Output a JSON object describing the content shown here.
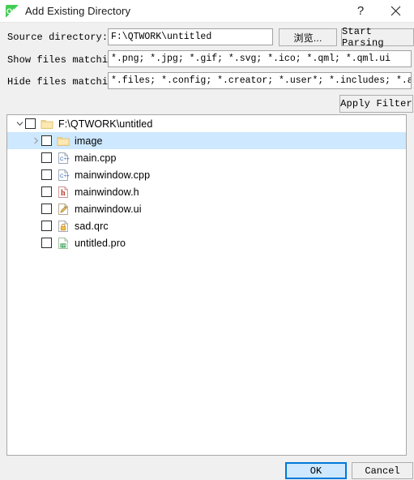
{
  "window": {
    "title": "Add Existing Directory",
    "icon": "qt-creator-icon",
    "help_label": "?",
    "close_label": "✕"
  },
  "form": {
    "source_label": "Source directory:",
    "source_value": "F:\\QTWORK\\untitled",
    "source_placeholder": "",
    "browse_label": "浏览...",
    "parse_label": "Start Parsing",
    "show_label": "Show files matching:",
    "show_value": "*.png; *.jpg; *.gif; *.svg; *.ico; *.qml; *.qml.ui",
    "show_placeholder": "",
    "hide_label": "Hide files matching:",
    "hide_value": "*.files; *.config; *.creator; *.user*; *.includes; *.autosave",
    "hide_placeholder": "",
    "apply_filter_label": "Apply Filter"
  },
  "tree": {
    "rows": [
      {
        "label": "F:\\QTWORK\\untitled",
        "icon": "folder-icon",
        "indent": 0,
        "expander": "expanded",
        "checked": false,
        "selected": false
      },
      {
        "label": "image",
        "icon": "folder-icon",
        "indent": 1,
        "expander": "collapsed",
        "checked": false,
        "selected": true
      },
      {
        "label": "main.cpp",
        "icon": "cpp-file-icon",
        "indent": 1,
        "expander": "none",
        "checked": false,
        "selected": false
      },
      {
        "label": "mainwindow.cpp",
        "icon": "cpp-file-icon",
        "indent": 1,
        "expander": "none",
        "checked": false,
        "selected": false
      },
      {
        "label": "mainwindow.h",
        "icon": "header-file-icon",
        "indent": 1,
        "expander": "none",
        "checked": false,
        "selected": false
      },
      {
        "label": "mainwindow.ui",
        "icon": "ui-designer-file-icon",
        "indent": 1,
        "expander": "none",
        "checked": false,
        "selected": false
      },
      {
        "label": "sad.qrc",
        "icon": "resource-file-icon",
        "indent": 1,
        "expander": "none",
        "checked": false,
        "selected": false
      },
      {
        "label": "untitled.pro",
        "icon": "project-file-icon",
        "indent": 1,
        "expander": "none",
        "checked": false,
        "selected": false
      }
    ]
  },
  "footer": {
    "ok_label": "OK",
    "cancel_label": "Cancel"
  },
  "colors": {
    "accent": "#0078d7",
    "selection": "#cde8ff",
    "window_bg": "#f0f0f0",
    "panel_bg": "#ffffff",
    "qt_green": "#41cd52"
  }
}
